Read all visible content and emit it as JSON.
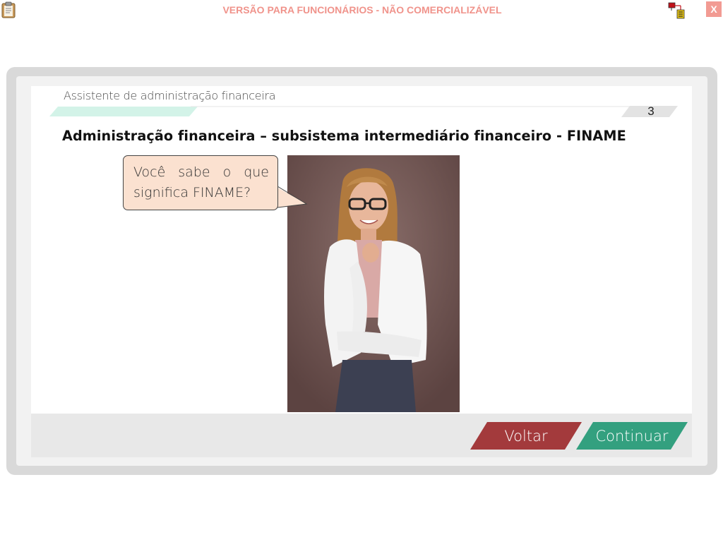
{
  "topbar": {
    "watermark": "VERSÃO PARA FUNCIONÁRIOS - NÃO COMERCIALIZÁVEL",
    "close_label": "X"
  },
  "header": {
    "assistant_label": "Assistente de administração financeira",
    "page_number": "3"
  },
  "slide": {
    "title": "Administração financeira – subsistema intermediário financeiro - FINAME",
    "bubble_text": "Você sabe o que significa FINAME?"
  },
  "footer": {
    "back_label": "Voltar",
    "next_label": "Continuar"
  },
  "colors": {
    "watermark": "#f0938b",
    "back_button": "#a33a3c",
    "next_button": "#33a07f",
    "bubble_fill": "#fbe1d0",
    "header_accent": "#d3f3e8"
  },
  "icons": {
    "clipboard": "clipboard-icon",
    "network": "network-status-icon",
    "close": "close-icon"
  }
}
